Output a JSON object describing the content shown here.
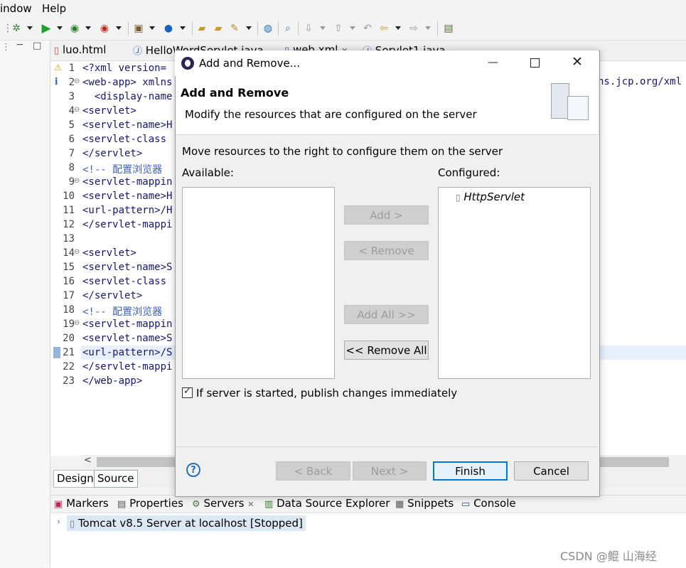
{
  "menu": {
    "items": [
      "indow",
      "Help"
    ]
  },
  "editor": {
    "tabs": [
      "luo.html",
      "HelloWordServlet.java",
      "web.xml",
      "Servlet1.java"
    ],
    "lines": [
      {
        "num": "1",
        "text": "<?xml version="
      },
      {
        "num": "2",
        "text": "<web-app> xmlns"
      },
      {
        "num": "3",
        "text": "  <display-name"
      },
      {
        "num": "4",
        "text": "<servlet>"
      },
      {
        "num": "5",
        "text": "<servlet-name>H"
      },
      {
        "num": "6",
        "text": "<servlet-class"
      },
      {
        "num": "7",
        "text": "</servlet>"
      },
      {
        "num": "8",
        "text": "<!-- 配置浏览器"
      },
      {
        "num": "9",
        "text": "<servlet-mappin"
      },
      {
        "num": "10",
        "text": "<servlet-name>H"
      },
      {
        "num": "11",
        "text": "<url-pattern>/H"
      },
      {
        "num": "12",
        "text": "</servlet-mappi"
      },
      {
        "num": "13",
        "text": ""
      },
      {
        "num": "14",
        "text": "<servlet>"
      },
      {
        "num": "15",
        "text": "<servlet-name>S"
      },
      {
        "num": "16",
        "text": "<servlet-class"
      },
      {
        "num": "17",
        "text": "</servlet>"
      },
      {
        "num": "18",
        "text": "<!-- 配置浏览器"
      },
      {
        "num": "19",
        "text": "<servlet-mappin"
      },
      {
        "num": "20",
        "text": "<servlet-name>S"
      },
      {
        "num": "21",
        "text": "<url-pattern>/S"
      },
      {
        "num": "22",
        "text": "</servlet-mappi"
      },
      {
        "num": "23",
        "text": "</web-app>"
      }
    ],
    "right_overflow_text": "ns.jcp.org/xml",
    "design_tabs": [
      "Design",
      "Source"
    ]
  },
  "bottom_panel": {
    "tabs": [
      "Markers",
      "Properties",
      "Servers",
      "Data Source Explorer",
      "Snippets",
      "Console"
    ],
    "server_row": "Tomcat v8.5 Server at localhost  [Stopped]"
  },
  "dialog": {
    "title": "Add and Remove...",
    "header_title": "Add and Remove",
    "header_subtitle": "Modify the resources that are configured on the server",
    "instruction": "Move resources to the right to configure them on the server",
    "available_label": "Available:",
    "configured_label": "Configured:",
    "configured_items": [
      "HttpServlet"
    ],
    "buttons": {
      "add": "Add >",
      "remove": "< Remove",
      "add_all": "Add All >>",
      "remove_all": "<< Remove All",
      "back": "< Back",
      "next": "Next >",
      "finish": "Finish",
      "cancel": "Cancel"
    },
    "checkbox_label": "If server is started, publish changes immediately",
    "checkbox_checked": true
  },
  "watermark": "CSDN @鲲  山海经"
}
